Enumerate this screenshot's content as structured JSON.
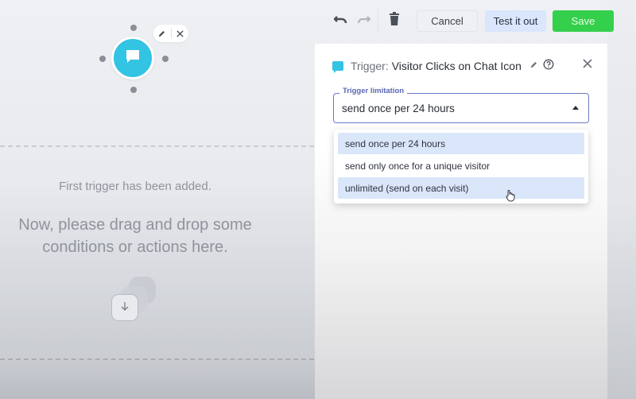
{
  "toolbar": {
    "undo_icon": "undo-icon",
    "redo_icon": "redo-icon",
    "delete_icon": "trash-icon",
    "cancel_label": "Cancel",
    "test_label": "Test it out",
    "save_label": "Save"
  },
  "canvas": {
    "node": {
      "icon": "chat-bubble-icon",
      "tools": [
        "pencil-icon",
        "close-icon"
      ]
    },
    "empty_state": {
      "first_line": "First trigger has been added.",
      "instruction": "Now, please drag and drop some conditions or actions here.",
      "drop_icon": "arrow-down-icon"
    }
  },
  "panel": {
    "trigger_prefix": "Trigger:",
    "trigger_name": "Visitor Clicks on Chat Icon",
    "select": {
      "label": "Trigger limitation",
      "value": "send once per 24 hours",
      "open": true,
      "options": [
        {
          "label": "send once per 24 hours",
          "selected": true
        },
        {
          "label": "send only once for a unique visitor",
          "selected": false
        },
        {
          "label": "unlimited (send on each visit)",
          "selected": false,
          "hovered": true
        }
      ]
    }
  },
  "colors": {
    "accent_cyan": "#33c3e3",
    "save_green": "#34d04c",
    "test_blue": "#d9e6fb",
    "select_border": "#6c7bc6",
    "option_highlight": "#dae6fa"
  }
}
